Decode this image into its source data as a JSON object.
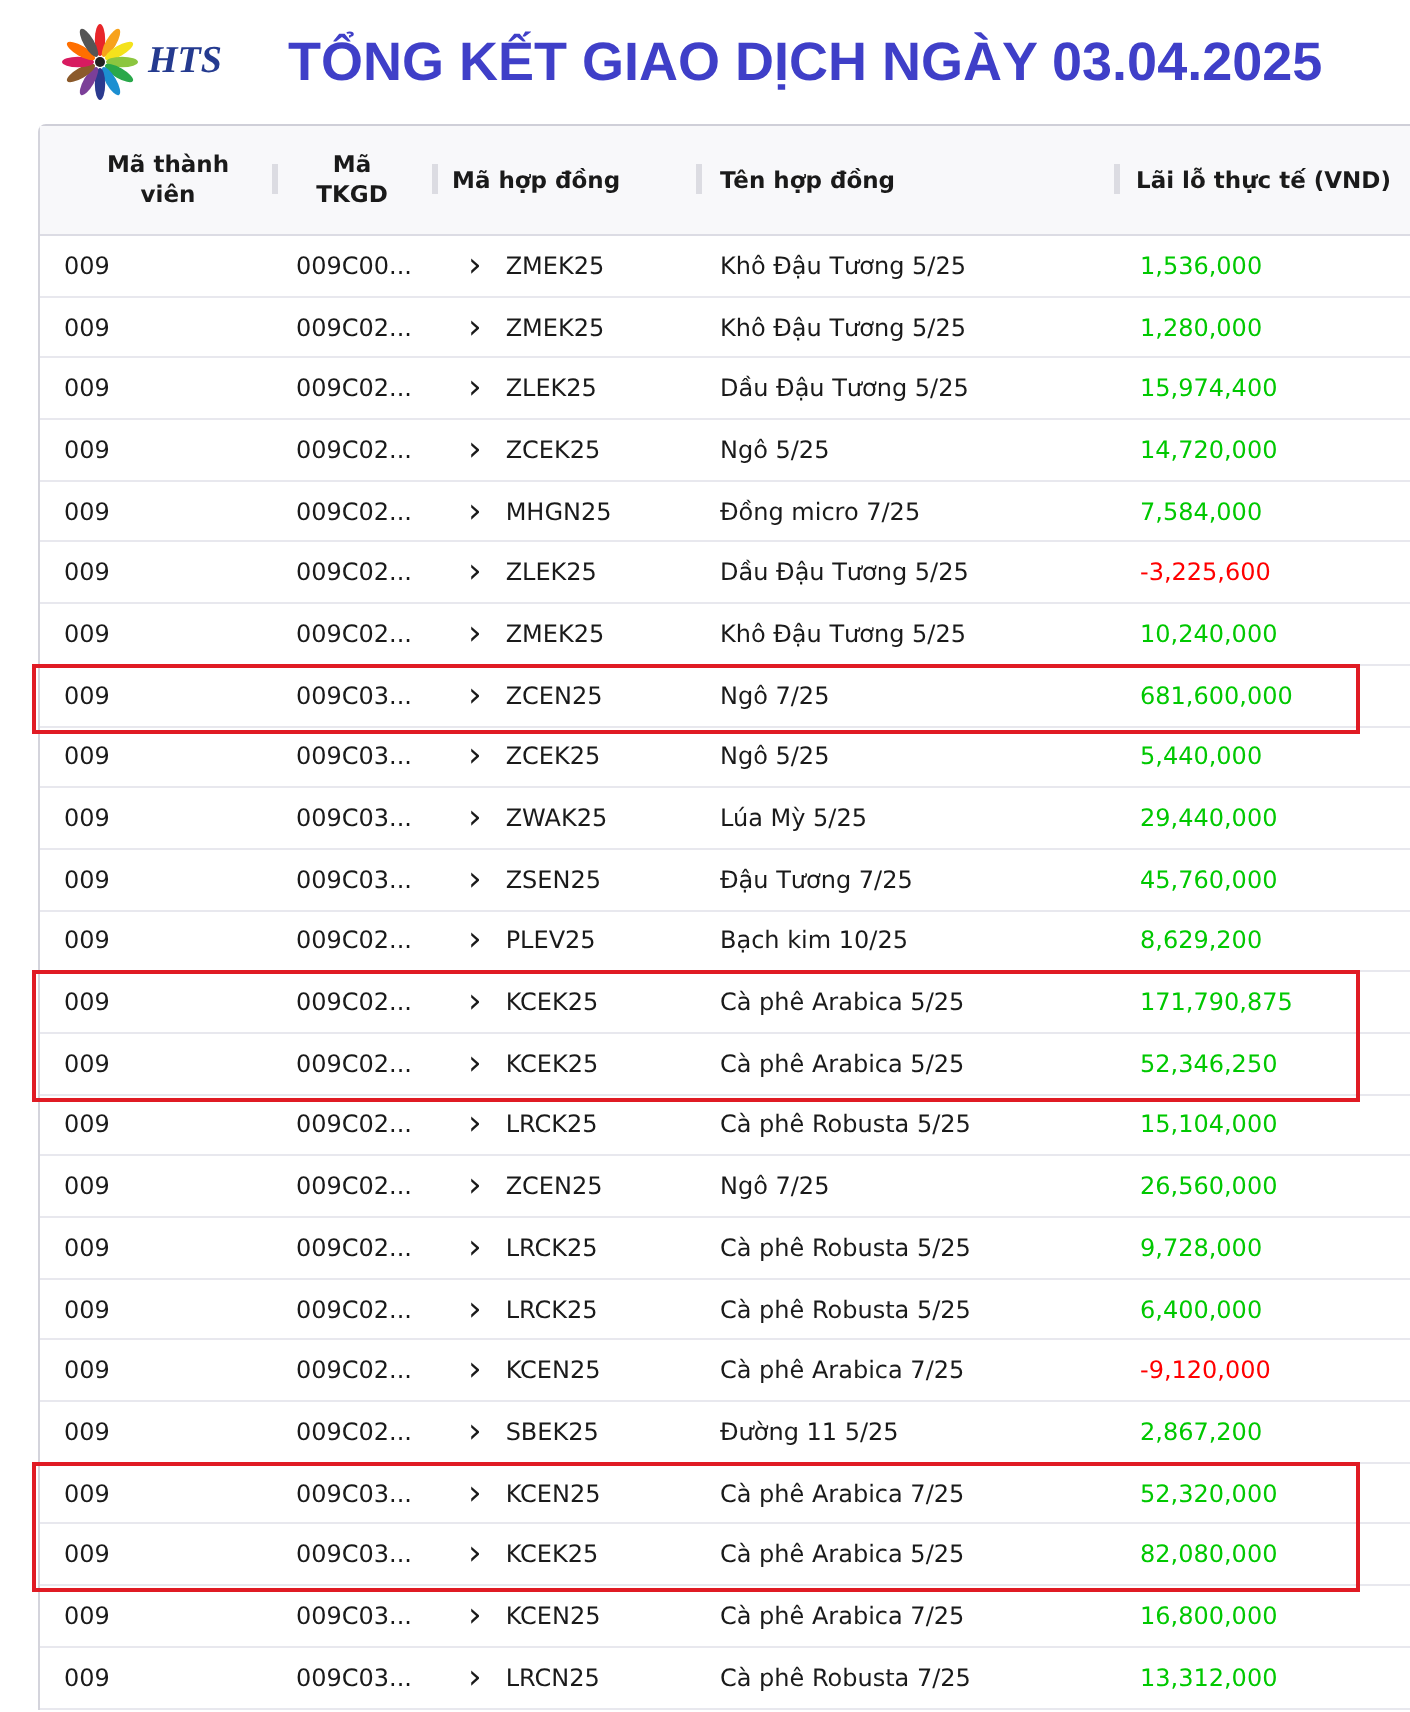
{
  "header": {
    "logo_text": "HTS",
    "title": "TỔNG KẾT GIAO DỊCH NGÀY 03.04.2025"
  },
  "table": {
    "columns": [
      "Mã thành viên",
      "Mã TKGD",
      "Mã hợp đồng",
      "Tên hợp đồng",
      "Lãi lỗ thực tế (VND)"
    ],
    "rows": [
      {
        "member": "009",
        "account": "009C00...",
        "expand": "›",
        "code": "ZMEK25",
        "name": "Khô Đậu Tương 5/25",
        "pnl": "1,536,000",
        "color": "#00c800",
        "highlighted": false
      },
      {
        "member": "009",
        "account": "009C02...",
        "expand": "›",
        "code": "ZMEK25",
        "name": "Khô Đậu Tương 5/25",
        "pnl": "1,280,000",
        "color": "#00c800",
        "highlighted": false
      },
      {
        "member": "009",
        "account": "009C02...",
        "expand": "›",
        "code": "ZLEK25",
        "name": "Dầu Đậu Tương 5/25",
        "pnl": "15,974,400",
        "color": "#00c800",
        "highlighted": false
      },
      {
        "member": "009",
        "account": "009C02...",
        "expand": "›",
        "code": "ZCEK25",
        "name": "Ngô 5/25",
        "pnl": "14,720,000",
        "color": "#00c800",
        "highlighted": false
      },
      {
        "member": "009",
        "account": "009C02...",
        "expand": "›",
        "code": "MHGN25",
        "name": "Đồng micro 7/25",
        "pnl": "7,584,000",
        "color": "#00c800",
        "highlighted": false
      },
      {
        "member": "009",
        "account": "009C02...",
        "expand": "›",
        "code": "ZLEK25",
        "name": "Dầu Đậu Tương 5/25",
        "pnl": "-3,225,600",
        "color": "#ff0000",
        "highlighted": false
      },
      {
        "member": "009",
        "account": "009C02...",
        "expand": "›",
        "code": "ZMEK25",
        "name": "Khô Đậu Tương 5/25",
        "pnl": "10,240,000",
        "color": "#00c800",
        "highlighted": false
      },
      {
        "member": "009",
        "account": "009C03...",
        "expand": "›",
        "code": "ZCEN25",
        "name": "Ngô 7/25",
        "pnl": "681,600,000",
        "color": "#00c800",
        "highlighted": true
      },
      {
        "member": "009",
        "account": "009C03...",
        "expand": "›",
        "code": "ZCEK25",
        "name": "Ngô 5/25",
        "pnl": "5,440,000",
        "color": "#00c800",
        "highlighted": false
      },
      {
        "member": "009",
        "account": "009C03...",
        "expand": "›",
        "code": "ZWAK25",
        "name": "Lúa Mỳ 5/25",
        "pnl": "29,440,000",
        "color": "#00c800",
        "highlighted": false
      },
      {
        "member": "009",
        "account": "009C03...",
        "expand": "›",
        "code": "ZSEN25",
        "name": "Đậu Tương 7/25",
        "pnl": "45,760,000",
        "color": "#00c800",
        "highlighted": false
      },
      {
        "member": "009",
        "account": "009C02...",
        "expand": "›",
        "code": "PLEV25",
        "name": "Bạch kim 10/25",
        "pnl": "8,629,200",
        "color": "#00c800",
        "highlighted": false
      },
      {
        "member": "009",
        "account": "009C02...",
        "expand": "›",
        "code": "KCEK25",
        "name": "Cà phê Arabica 5/25",
        "pnl": "171,790,875",
        "color": "#00c800",
        "highlighted": true
      },
      {
        "member": "009",
        "account": "009C02...",
        "expand": "›",
        "code": "KCEK25",
        "name": "Cà phê Arabica 5/25",
        "pnl": "52,346,250",
        "color": "#00c800",
        "highlighted": true
      },
      {
        "member": "009",
        "account": "009C02...",
        "expand": "›",
        "code": "LRCK25",
        "name": "Cà phê Robusta 5/25",
        "pnl": "15,104,000",
        "color": "#00c800",
        "highlighted": false
      },
      {
        "member": "009",
        "account": "009C02...",
        "expand": "›",
        "code": "ZCEN25",
        "name": "Ngô 7/25",
        "pnl": "26,560,000",
        "color": "#00c800",
        "highlighted": false
      },
      {
        "member": "009",
        "account": "009C02...",
        "expand": "›",
        "code": "LRCK25",
        "name": "Cà phê Robusta 5/25",
        "pnl": "9,728,000",
        "color": "#00c800",
        "highlighted": false
      },
      {
        "member": "009",
        "account": "009C02...",
        "expand": "›",
        "code": "LRCK25",
        "name": "Cà phê Robusta 5/25",
        "pnl": "6,400,000",
        "color": "#00c800",
        "highlighted": false
      },
      {
        "member": "009",
        "account": "009C02...",
        "expand": "›",
        "code": "KCEN25",
        "name": "Cà phê Arabica 7/25",
        "pnl": "-9,120,000",
        "color": "#ff0000",
        "highlighted": false
      },
      {
        "member": "009",
        "account": "009C02...",
        "expand": "›",
        "code": "SBEK25",
        "name": "Đường 11 5/25",
        "pnl": "2,867,200",
        "color": "#00c800",
        "highlighted": false
      },
      {
        "member": "009",
        "account": "009C03...",
        "expand": "›",
        "code": "KCEN25",
        "name": "Cà phê Arabica 7/25",
        "pnl": "52,320,000",
        "color": "#00c800",
        "highlighted": true
      },
      {
        "member": "009",
        "account": "009C03...",
        "expand": "›",
        "code": "KCEK25",
        "name": "Cà phê Arabica 5/25",
        "pnl": "82,080,000",
        "color": "#00c800",
        "highlighted": true
      },
      {
        "member": "009",
        "account": "009C03...",
        "expand": "›",
        "code": "KCEN25",
        "name": "Cà phê Arabica 7/25",
        "pnl": "16,800,000",
        "color": "#00c800",
        "highlighted": false
      },
      {
        "member": "009",
        "account": "009C03...",
        "expand": "›",
        "code": "LRCN25",
        "name": "Cà phê Robusta 7/25",
        "pnl": "13,312,000",
        "color": "#00c800",
        "highlighted": false
      }
    ]
  }
}
